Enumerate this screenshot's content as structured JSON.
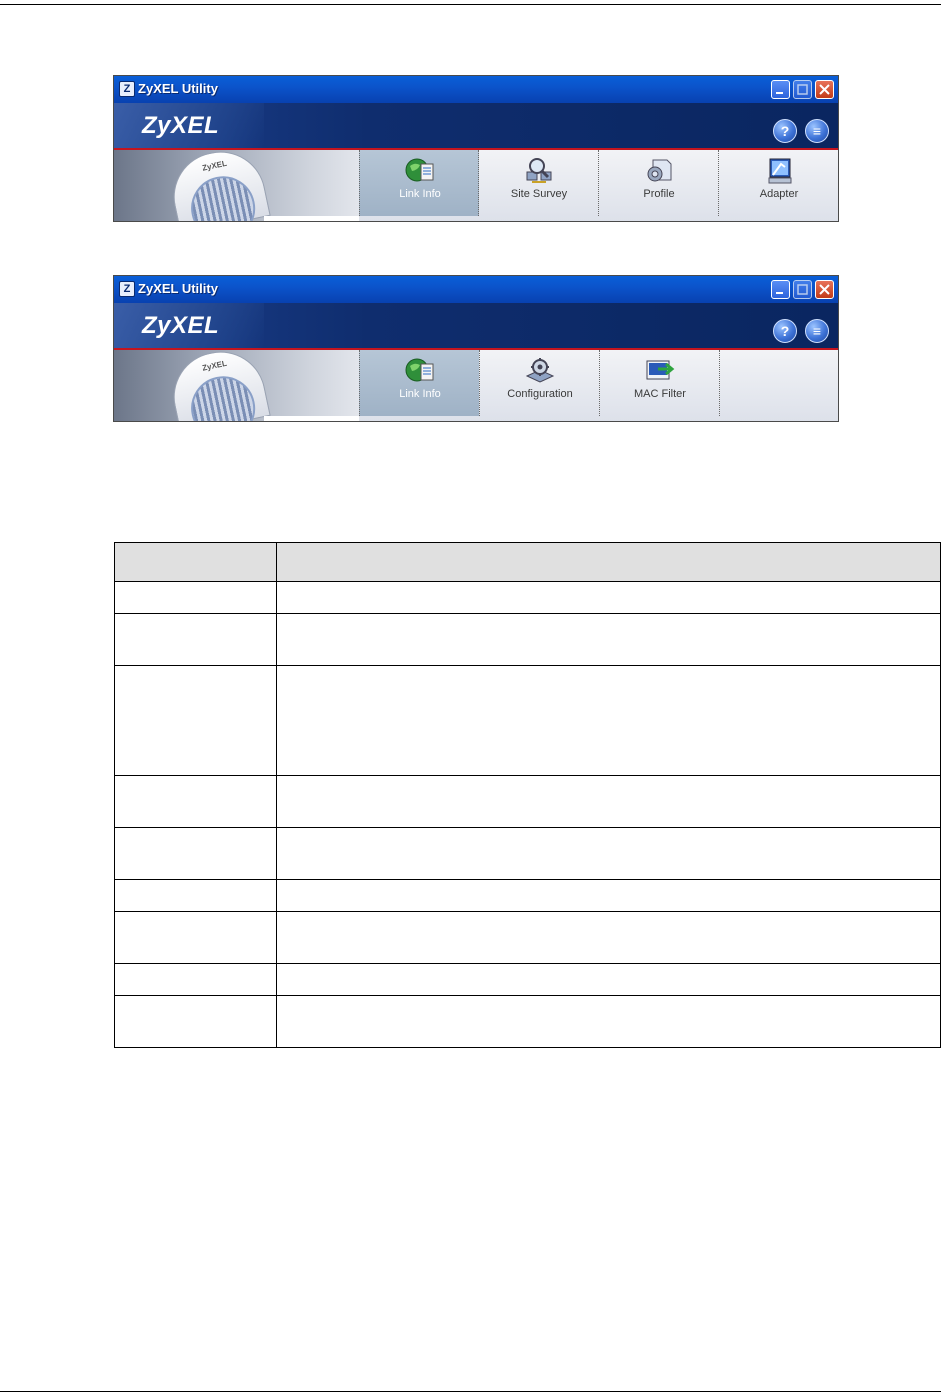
{
  "windows": [
    {
      "title": "ZyXEL Utility",
      "brand": "ZyXEL",
      "device_badge": "ZyXEL",
      "nav": [
        {
          "label": "Link Info",
          "icon": "link-info-icon",
          "active": true
        },
        {
          "label": "Site Survey",
          "icon": "site-survey-icon",
          "active": false
        },
        {
          "label": "Profile",
          "icon": "profile-icon",
          "active": false
        },
        {
          "label": "Adapter",
          "icon": "adapter-icon",
          "active": false
        }
      ]
    },
    {
      "title": "ZyXEL Utility",
      "brand": "ZyXEL",
      "device_badge": "ZyXEL",
      "nav": [
        {
          "label": "Link Info",
          "icon": "link-info-icon",
          "active": true
        },
        {
          "label": "Configuration",
          "icon": "configuration-icon",
          "active": false
        },
        {
          "label": "MAC Filter",
          "icon": "mac-filter-icon",
          "active": false
        },
        {
          "label": "",
          "icon": "",
          "active": false
        }
      ]
    }
  ],
  "title_icon_letter": "Z",
  "help_glyph": "?",
  "about_glyph": "≡",
  "colors": {
    "titlebar": "#0b52c9",
    "brand_red_line": "#c4151f",
    "active_tab": "#9fb2c6"
  },
  "table": {
    "headers": [
      "",
      ""
    ],
    "row_count": 9
  }
}
